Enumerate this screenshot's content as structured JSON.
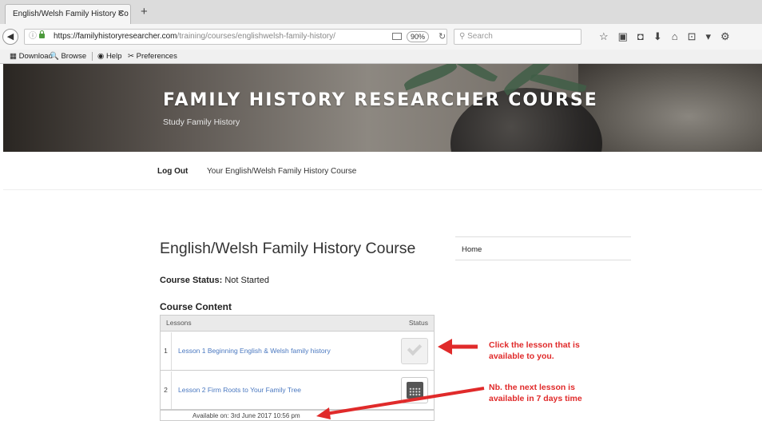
{
  "browser": {
    "tab_title": "English/Welsh Family History Co",
    "tab_close": "✕",
    "new_tab": "+",
    "url_host": "https://familyhistoryresearcher.com",
    "url_path": "/training/courses/englishwelsh-family-history/",
    "zoom": "90%",
    "search_placeholder": "Search",
    "bookmarks": [
      "Download",
      "Browse",
      "Help",
      "Preferences"
    ]
  },
  "header": {
    "title": "FAMILY HISTORY RESEARCHER COURSE",
    "subtitle": "Study Family History"
  },
  "nav": {
    "logout": "Log Out",
    "course_link": "Your English/Welsh Family History Course"
  },
  "course": {
    "title": "English/Welsh Family History Course",
    "status_label": "Course Status:",
    "status_value": "Not Started",
    "content_heading": "Course Content",
    "col_lessons": "Lessons",
    "col_status": "Status",
    "lessons": [
      {
        "num": "1",
        "title": "Lesson 1 Beginning English & Welsh family history"
      },
      {
        "num": "2",
        "title": "Lesson 2 Firm Roots to Your Family Tree"
      }
    ],
    "availability": "Available on: 3rd June 2017 10:56 pm"
  },
  "sidebar": {
    "home": "Home"
  },
  "annotations": {
    "note1_line1": "Click the lesson that is",
    "note1_line2": "available to you.",
    "note2_line1": "Nb. the next lesson is",
    "note2_line2": "available in 7 days time",
    "color": "#e02a2a"
  }
}
